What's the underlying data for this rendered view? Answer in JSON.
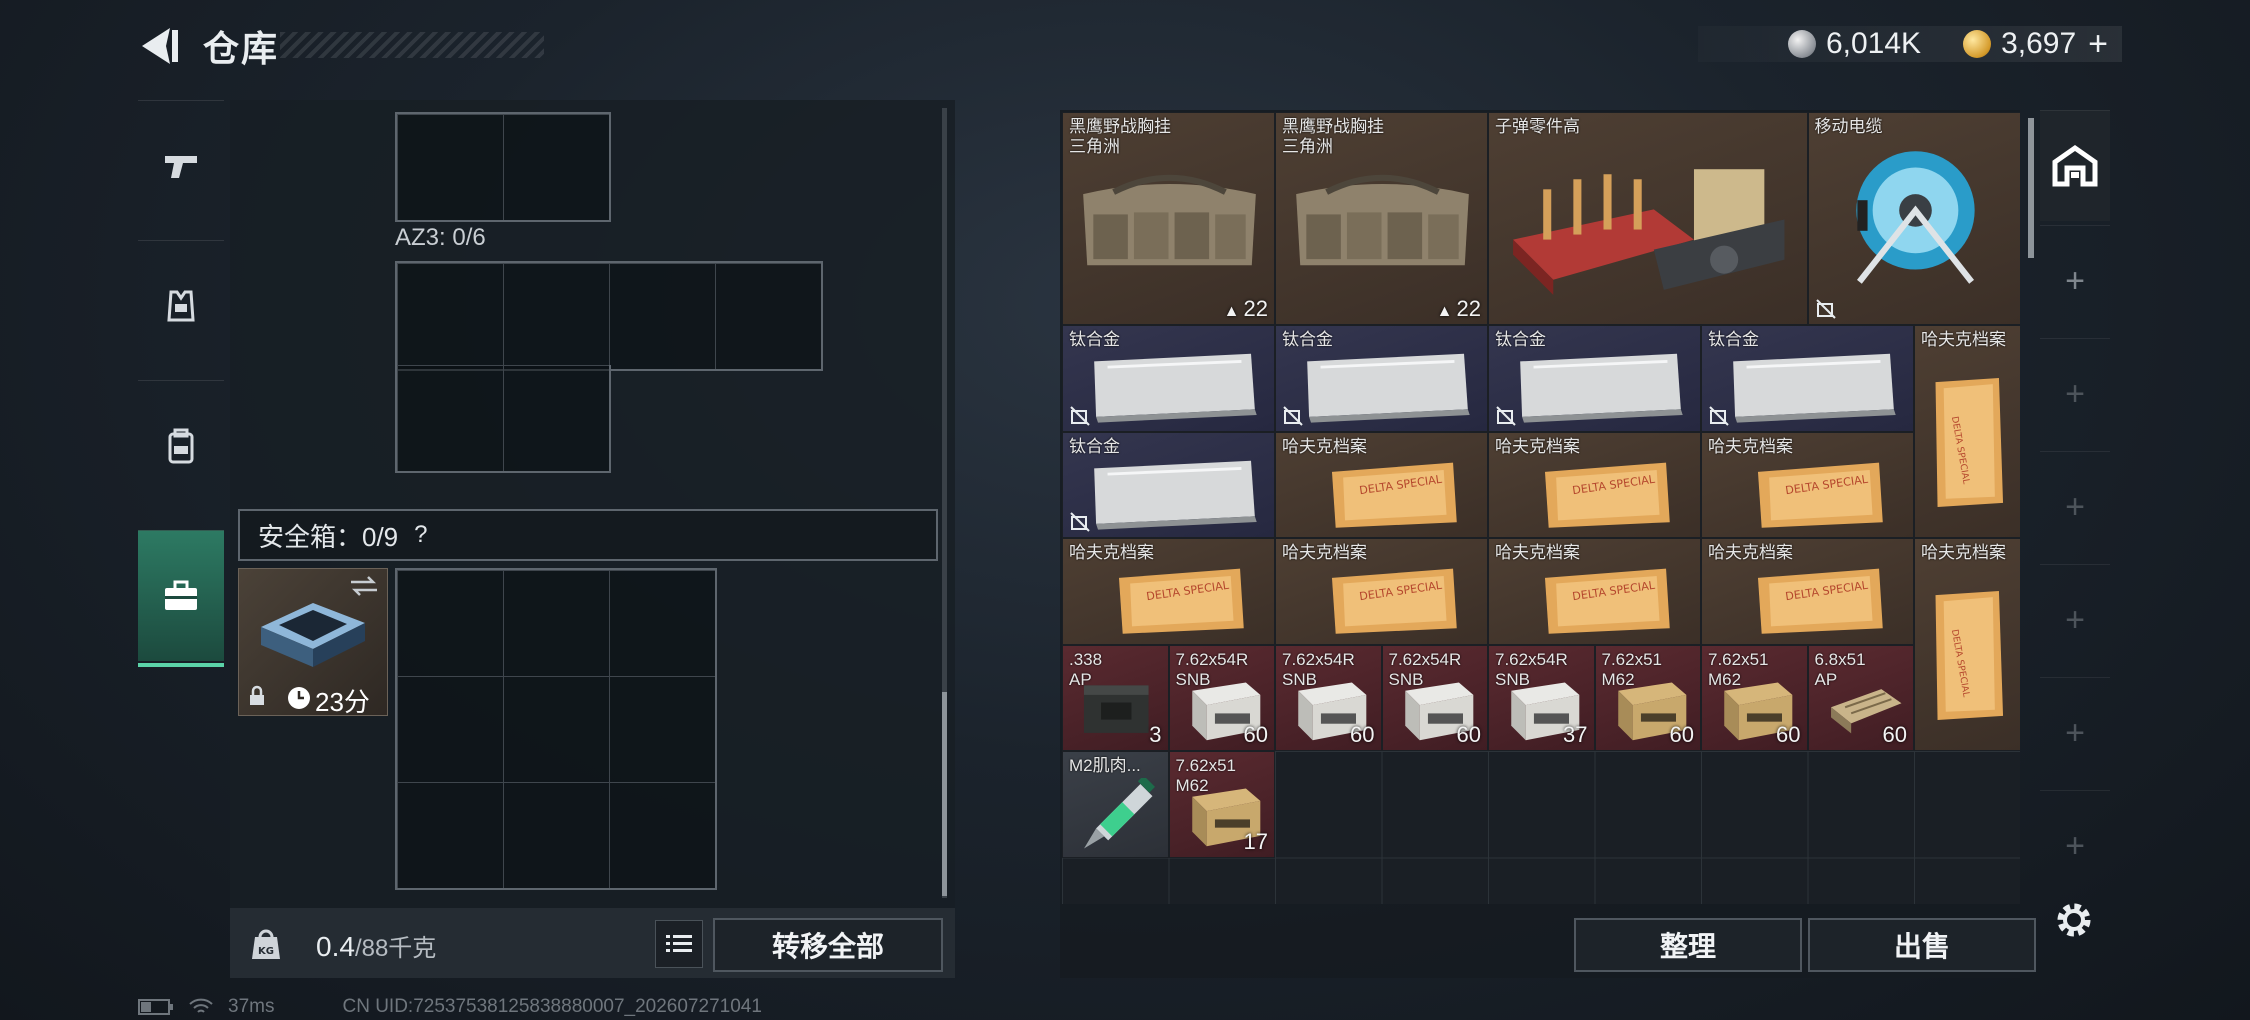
{
  "header": {
    "title": "仓库",
    "silver_amount": "6,014K",
    "gold_amount": "3,697",
    "plus_label": "+"
  },
  "side_tabs": [
    {
      "name": "weapons"
    },
    {
      "name": "armor"
    },
    {
      "name": "backpack"
    },
    {
      "name": "safe-box",
      "active": true
    }
  ],
  "left_panel": {
    "az3_label": "AZ3: 0/6",
    "safe_box_label": "安全箱：0/9",
    "help_label": "?",
    "safe_timer": "23分",
    "weight_value": "0.4",
    "weight_capacity": "/88千克",
    "transfer_all": "转移全部"
  },
  "storage_items": [
    {
      "name": "黑鹰野战胸挂\n三角洲",
      "count": "22",
      "color": "brown",
      "art": "rig"
    },
    {
      "name": "黑鹰野战胸挂\n三角洲",
      "count": "22",
      "color": "brown",
      "art": "rig"
    },
    {
      "name": "子弹零件高",
      "count": "",
      "color": "brown",
      "art": "parts"
    },
    {
      "name": "移动电缆",
      "count": "",
      "color": "brown",
      "art": "cable"
    },
    {
      "name": "钛合金",
      "count": "",
      "color": "navy",
      "art": "plate"
    },
    {
      "name": "钛合金",
      "count": "",
      "color": "navy",
      "art": "plate"
    },
    {
      "name": "钛合金",
      "count": "",
      "color": "navy",
      "art": "plate"
    },
    {
      "name": "钛合金",
      "count": "",
      "color": "navy",
      "art": "plate"
    },
    {
      "name": "哈夫克档案",
      "count": "",
      "color": "brown",
      "art": "folder_tall"
    },
    {
      "name": "钛合金",
      "count": "",
      "color": "navy",
      "art": "plate"
    },
    {
      "name": "哈夫克档案",
      "count": "",
      "color": "brown",
      "art": "folder"
    },
    {
      "name": "哈夫克档案",
      "count": "",
      "color": "brown",
      "art": "folder"
    },
    {
      "name": "哈夫克档案",
      "count": "",
      "color": "brown",
      "art": "folder"
    },
    {
      "name": "哈夫克档案",
      "count": "",
      "color": "brown",
      "art": "folder"
    },
    {
      "name": "哈夫克档案",
      "count": "",
      "color": "brown",
      "art": "folder"
    },
    {
      "name": "哈夫克档案",
      "count": "",
      "color": "brown",
      "art": "folder"
    },
    {
      "name": "哈夫克档案",
      "count": "",
      "color": "brown",
      "art": "folder"
    },
    {
      "name": "哈夫克档案",
      "count": "",
      "color": "brown",
      "art": "folder_tall"
    },
    {
      "name": ".338\nAP",
      "count": "3",
      "color": "red",
      "art": "ammo_dark"
    },
    {
      "name": "7.62x54R\nSNB",
      "count": "60",
      "color": "red",
      "art": "ammo_box"
    },
    {
      "name": "7.62x54R\nSNB",
      "count": "60",
      "color": "red",
      "art": "ammo_box"
    },
    {
      "name": "7.62x54R\nSNB",
      "count": "60",
      "color": "red",
      "art": "ammo_box"
    },
    {
      "name": "7.62x54R\nSNB",
      "count": "37",
      "color": "red",
      "art": "ammo_box"
    },
    {
      "name": "7.62x51\nM62",
      "count": "60",
      "color": "red",
      "art": "ammo_tan"
    },
    {
      "name": "7.62x51\nM62",
      "count": "60",
      "color": "red",
      "art": "ammo_tan"
    },
    {
      "name": "6.8x51\nAP",
      "count": "60",
      "color": "red",
      "art": "ammo_clip"
    },
    {
      "name": "M2肌肉...",
      "count": "",
      "color": "gray",
      "art": "syringe"
    },
    {
      "name": "7.62x51\nM62",
      "count": "17",
      "color": "red",
      "art": "ammo_tan"
    }
  ],
  "storage_actions": {
    "organize": "整理",
    "sell": "出售"
  },
  "status_bar": {
    "ping": "37ms",
    "uid": "CN UID:72537538125838880007_202607271041"
  },
  "colors": {
    "accent_green": "#5bd3a8",
    "brown_rarity": "#4e3f33",
    "navy_rarity": "#34364f",
    "red_rarity": "#5a2a30"
  }
}
